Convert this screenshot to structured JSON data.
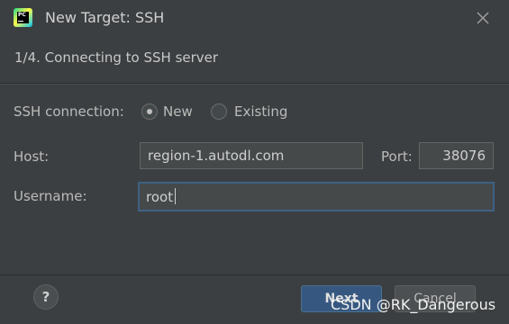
{
  "window": {
    "title": "New Target: SSH",
    "app_icon_text": "PC",
    "close_icon": "close-icon"
  },
  "step": {
    "label": "1/4. Connecting to SSH server"
  },
  "form": {
    "connection": {
      "label": "SSH connection:",
      "options": [
        {
          "label": "New",
          "selected": true
        },
        {
          "label": "Existing",
          "selected": false
        }
      ]
    },
    "host": {
      "label": "Host:",
      "value": "region-1.autodl.com"
    },
    "port": {
      "label": "Port:",
      "value": "38076"
    },
    "username": {
      "label": "Username:",
      "value": "root"
    }
  },
  "footer": {
    "help_label": "?",
    "next_label": "Next",
    "cancel_label": "Cancel"
  },
  "watermark": "CSDN @RK_Dangerous",
  "colors": {
    "background": "#3c3f41",
    "field_background": "#45494a",
    "focus_border": "#3d6185",
    "primary_button": "#365880"
  }
}
